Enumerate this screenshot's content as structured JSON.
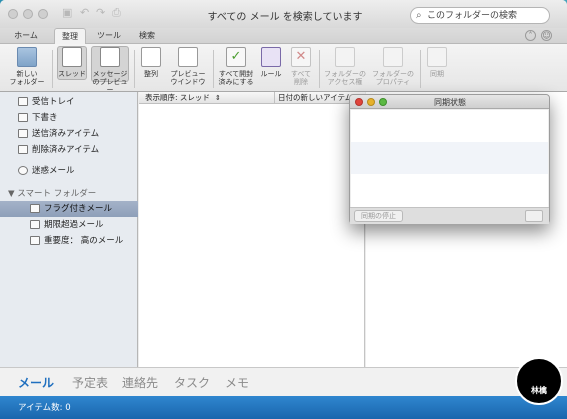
{
  "window": {
    "title": "すべての メール を検索しています",
    "search_placeholder": "このフォルダーの検索"
  },
  "ribbon_tabs": [
    "ホーム",
    "整理",
    "ツール",
    "検索"
  ],
  "ribbon_active_tab": "整理",
  "ribbon": {
    "new_folder": "新しい\nフォルダー",
    "thread": "スレッド",
    "message_preview": "メッセージ\nのプレビュー",
    "columns": "整列",
    "preview_window": "プレビュー\nウインドウ",
    "mark_all_read": "すべて開封\n済みにする",
    "rules": "ルール",
    "delete_all": "すべて\n削除",
    "folder_access": "フォルダーの\nアクセス権",
    "folder_properties": "フォルダーの\nプロパティ",
    "sync": "同期"
  },
  "sidebar": {
    "items": [
      {
        "label": "受信トレイ",
        "icon": "inbox-icon"
      },
      {
        "label": "下書き",
        "icon": "draft-icon"
      },
      {
        "label": "送信済みアイテム",
        "icon": "sent-icon"
      },
      {
        "label": "削除済みアイテム",
        "icon": "trash-icon"
      },
      {
        "label": "迷惑メール",
        "icon": "junk-icon"
      }
    ],
    "smart_folders_header": "スマート フォルダー",
    "smart_folders": [
      {
        "label": "フラグ付きメール",
        "selected": true
      },
      {
        "label": "期限超過メール",
        "selected": false
      },
      {
        "label": "重要度： 高のメール",
        "selected": false
      }
    ]
  },
  "message_list": {
    "sort_label": "表示順序: スレッド",
    "sort_column": "日付の新しいアイテム"
  },
  "sync_panel": {
    "title": "同期状態",
    "stop_button": "同期の停止"
  },
  "bottom_nav": [
    "メール",
    "予定表",
    "連絡先",
    "タスク",
    "メモ"
  ],
  "bottom_nav_active": "メール",
  "status": {
    "item_count": "アイテム数: 0"
  },
  "badge": {
    "text": "林檎"
  },
  "colors": {
    "accent": "#1f6fbf",
    "status_bar": "#2a7cc4",
    "selection": "#98a8c0"
  }
}
